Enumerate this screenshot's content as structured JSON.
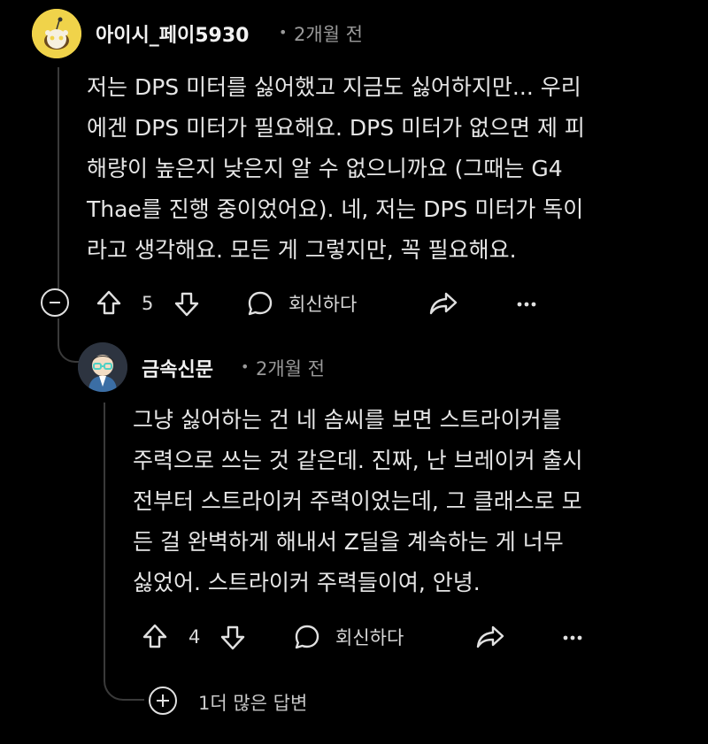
{
  "comment": {
    "username": "아이시_페이5930",
    "time": "2개월 전",
    "body_lines": [
      "저는 DPS 미터를 싫어했고 지금도 싫어하지만... 우리",
      "에겐 DPS 미터가 필요해요. DPS 미터가 없으면 제 피",
      "해량이 높은지 낮은지 알 수 없으니까요 (그때는 G4",
      "Thae를 진행 중이었어요). 네, 저는 DPS 미터가 독이",
      "라고 생각해요. 모든 게 그렇지만, 꼭 필요해요."
    ],
    "votes": "5",
    "reply_label": "회신하다"
  },
  "reply": {
    "username": "금속신문",
    "time": "2개월 전",
    "body_lines": [
      "그냥 싫어하는 건 네 솜씨를 보면 스트라이커를",
      "주력으로 쓰는 것 같은데. 진짜, 난 브레이커 출시",
      "전부터 스트라이커 주력이었는데, 그 클래스로 모",
      "든 걸 완벽하게 해내서 Z딜을 계속하는 게 너무",
      "싫었어. 스트라이커 주력들이여, 안녕."
    ],
    "votes": "4",
    "reply_label": "회신하다"
  },
  "more_replies": "1더 많은 답변",
  "icons": {
    "upvote": "upvote-arrow-icon",
    "downvote": "downvote-arrow-icon",
    "reply": "speech-bubble-icon",
    "share": "share-arrow-icon",
    "more": "ellipsis-icon",
    "collapse": "minus-circle-icon",
    "expand": "plus-circle-icon"
  },
  "colors": {
    "background": "#000000",
    "text": "#e6e6e6",
    "meta": "#9a9a9a",
    "avatar_main": "#f0d34a"
  }
}
